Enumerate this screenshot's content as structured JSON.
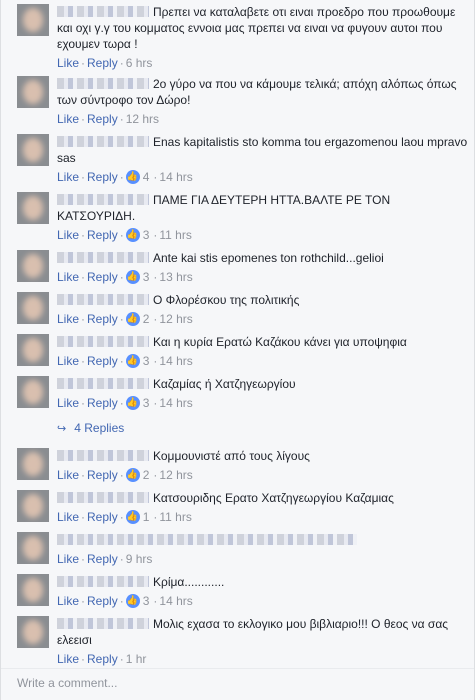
{
  "comments": [
    {
      "text": "Πρεπει να καταλαβετε οτι ειναι προεδρο που προωθουμε και οχι γ.γ του κομματος εννοια μας πρεπει να ειναι να φυγουν αυτοι που εχουμεν τωρα !",
      "like": "Like",
      "reply": "Reply",
      "time": "6 hrs",
      "likes": ""
    },
    {
      "text": "2ο γύρο να που να κάμουμε τελικά; απόχη αλόπως όπως των σύντροφο τον Δώρο!",
      "like": "Like",
      "reply": "Reply",
      "time": "12 hrs",
      "likes": ""
    },
    {
      "text": "Enas kapitalistis sto komma tou ergazomenou laou mpravo sas",
      "like": "Like",
      "reply": "Reply",
      "time": "14 hrs",
      "likes": "4"
    },
    {
      "text": "ΠΑΜΕ ΓΙΑ ΔΕΥΤΕΡΗ ΗΤΤΑ.ΒΑΛΤΕ ΡΕ ΤΟΝ ΚΑΤΣΟΥΡΙΔΗ.",
      "like": "Like",
      "reply": "Reply",
      "time": "11 hrs",
      "likes": "3"
    },
    {
      "text": "Ante kai stis epomenes ton rothchild...gelioi",
      "like": "Like",
      "reply": "Reply",
      "time": "13 hrs",
      "likes": "3"
    },
    {
      "text": "Ο Φλορέσκου της πολιτικής",
      "like": "Like",
      "reply": "Reply",
      "time": "12 hrs",
      "likes": "2"
    },
    {
      "text": "Και η κυρία Ερατώ Καζάκου κάνει για υποψηφια",
      "like": "Like",
      "reply": "Reply",
      "time": "14 hrs",
      "likes": "3"
    },
    {
      "text": "Καζαμίας ή Χατζηγεωργίου",
      "like": "Like",
      "reply": "Reply",
      "time": "14 hrs",
      "likes": "3"
    },
    {
      "text": "Κομμουνιστέ από τους λίγους",
      "like": "Like",
      "reply": "Reply",
      "time": "12 hrs",
      "likes": "2"
    },
    {
      "text": "Κατσουριδης Ερατο Χατζηγεωργίου Καζαμιας",
      "like": "Like",
      "reply": "Reply",
      "time": "11 hrs",
      "likes": "1"
    },
    {
      "text": "",
      "like": "Like",
      "reply": "Reply",
      "time": "9 hrs",
      "likes": ""
    },
    {
      "text": "Κρίμα............",
      "like": "Like",
      "reply": "Reply",
      "time": "14 hrs",
      "likes": "3"
    },
    {
      "text": "Μολις εχασα το εκλογικο μου βιβλιαριο!!! Ο θεος να σας ελεεισι",
      "like": "Like",
      "reply": "Reply",
      "time": "1 hr",
      "likes": ""
    }
  ],
  "replies_link": "4 Replies",
  "write_placeholder": "Write a comment...",
  "colors": {
    "link": "#4267b2",
    "meta": "#90949c",
    "like_badge": "#5890ff"
  }
}
